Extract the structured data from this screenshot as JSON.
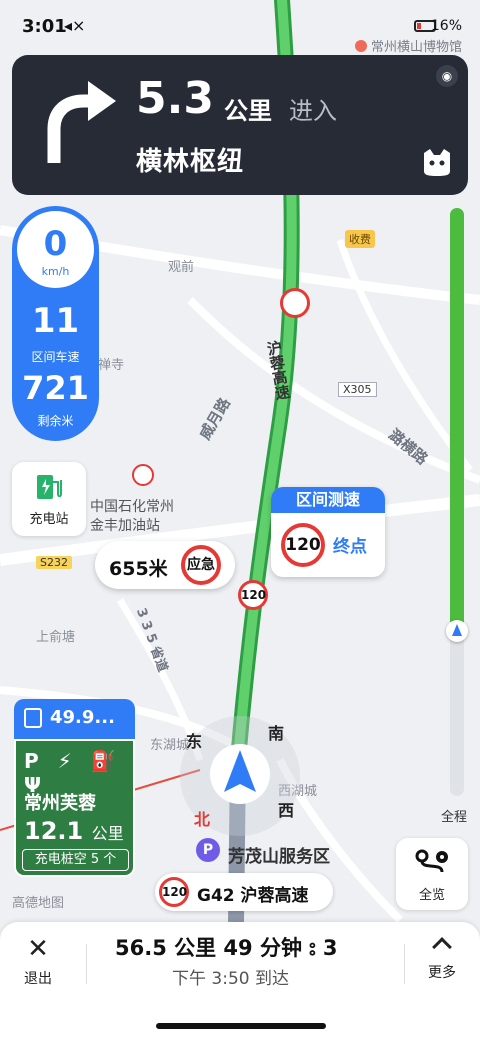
{
  "status_bar": {
    "time": "3:01",
    "battery": "16%"
  },
  "map": {
    "poi_museum": "常州横山博物馆",
    "labels": {
      "guan_qian": "观前",
      "chan_si": "禅寺",
      "shou_fei": "收费",
      "x305": "X305",
      "s232": "S232",
      "shang_yu_tang": "上俞塘",
      "dong_hu_cheng": "东湖城",
      "xi_hu_cheng": "西湖城",
      "gas_station": "中国石化常州\n金丰加油站"
    },
    "roads": {
      "hu_rong": "沪蓉高速",
      "wei_yue": "威月路",
      "lu_heng": "潞横路",
      "s_road": "3 3 5 省道"
    },
    "speed_sign_small": "120",
    "compass": {
      "north": "北",
      "south": "南",
      "east": "东",
      "west": "西"
    }
  },
  "guidance": {
    "distance": "5.3",
    "unit": "公里",
    "action": "进入",
    "road": "横林枢纽"
  },
  "speed_panel": {
    "current_speed": "0",
    "speed_unit": "km/h",
    "section_speed": "11",
    "section_speed_label": "区间车速",
    "remaining": "721",
    "remaining_label": "剩余米"
  },
  "charging": {
    "label": "充电站"
  },
  "section_check": {
    "title": "区间测速",
    "limit": "120",
    "end_label": "终点"
  },
  "emergency": {
    "distance": "655米",
    "label": "应急"
  },
  "progress": {
    "fraction_traveled": 0.72,
    "label": "全程"
  },
  "service_area": {
    "battery_value": "49.9...",
    "icons": "P ⚡ ⛽ Ψ",
    "name": "常州芙蓉",
    "distance": "12.1",
    "distance_unit": "公里",
    "pile_status": "充电桩空 5 个"
  },
  "service_poi": {
    "label": "芳茂山服务区"
  },
  "current_road": {
    "limit": "120",
    "name": "G42 沪蓉高速"
  },
  "overview": {
    "label": "全览"
  },
  "brand": "高德地图",
  "bottom": {
    "exit_label": "退出",
    "summary": "56.5 公里  49 分钟  ⦂ 3",
    "arrival": "下午 3:50 到达",
    "more_label": "更多"
  }
}
